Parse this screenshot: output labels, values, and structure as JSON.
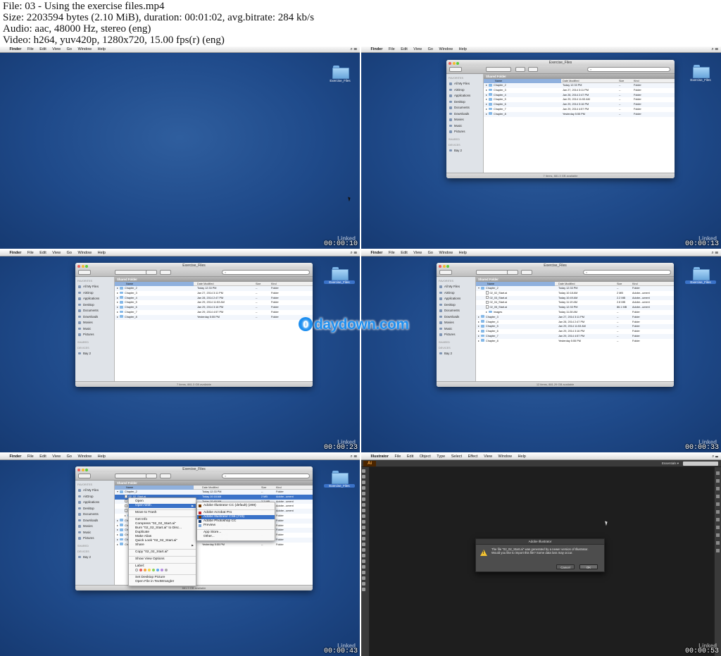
{
  "info": {
    "line1": "File: 03 - Using the exercise files.mp4",
    "line2": "Size: 2203594 bytes (2.10 MiB), duration: 00:01:02, avg.bitrate: 284 kb/s",
    "line3": "Audio: aac, 48000 Hz, stereo (eng)",
    "line4": "Video: h264, yuv420p, 1280x720, 15.00 fps(r) (eng)"
  },
  "finder_menu": [
    "Finder",
    "File",
    "Edit",
    "View",
    "Go",
    "Window",
    "Help"
  ],
  "ai_menu": [
    "Illustrator",
    "File",
    "Edit",
    "Object",
    "Type",
    "Select",
    "Effect",
    "View",
    "Window",
    "Help"
  ],
  "desktop_icon_label": "Exercise_Files",
  "window_title": "Exercise_Files",
  "shared_folder": "Shared Folder",
  "sidebar": {
    "favorites_header": "FAVORITES",
    "favorites": [
      "All My Files",
      "AirDrop",
      "Applications",
      "Desktop",
      "Documents",
      "Downloads",
      "Movies",
      "Music",
      "Pictures"
    ],
    "shared_header": "SHARED",
    "devices_header": "DEVICES",
    "devices": [
      "Bay 2"
    ]
  },
  "columns": {
    "name": "Name",
    "date": "Date Modified",
    "size": "Size",
    "kind": "Kind"
  },
  "rows": [
    {
      "name": "Chapter_2",
      "date": "Today 12:33 PM",
      "size": "--",
      "kind": "Folder"
    },
    {
      "name": "Chapter_3",
      "date": "Jan 27, 2014 3:11 PM",
      "size": "--",
      "kind": "Folder"
    },
    {
      "name": "Chapter_4",
      "date": "Jan 28, 2014 2:47 PM",
      "size": "--",
      "kind": "Folder"
    },
    {
      "name": "Chapter_5",
      "date": "Jan 29, 2014 11:53 AM",
      "size": "--",
      "kind": "Folder"
    },
    {
      "name": "Chapter_6",
      "date": "Jan 29, 2014 3:16 PM",
      "size": "--",
      "kind": "Folder"
    },
    {
      "name": "Chapter_7",
      "date": "Jan 29, 2014 4:57 PM",
      "size": "--",
      "kind": "Folder"
    },
    {
      "name": "Chapter_8",
      "date": "Yesterday 5:55 PM",
      "size": "--",
      "kind": "Folder"
    }
  ],
  "expanded_rows": [
    {
      "name": "Chapter_2",
      "date": "Today 12:33 PM",
      "size": "--",
      "kind": "Folder",
      "type": "folder",
      "open": true
    },
    {
      "name": "02_02_Start.ai",
      "date": "Today 10:18 AM",
      "size": "2 MB",
      "kind": "Adobe...ument",
      "type": "file"
    },
    {
      "name": "02_03_Start.ai",
      "date": "Today 10:49 AM",
      "size": "2.2 MB",
      "kind": "Adobe...ument",
      "type": "file"
    },
    {
      "name": "02_04_Start.ai",
      "date": "Today 11:19 AM",
      "size": "2.8 MB",
      "kind": "Adobe...ument",
      "type": "file"
    },
    {
      "name": "02_05_Start.ai",
      "date": "Today 12:33 PM",
      "size": "86.1 MB",
      "kind": "Adobe...ument",
      "type": "file"
    },
    {
      "name": "images",
      "date": "Today 11:28 AM",
      "size": "--",
      "kind": "Folder",
      "type": "folder"
    },
    {
      "name": "Chapter_3",
      "date": "Jan 27, 2014 3:11 PM",
      "size": "--",
      "kind": "Folder",
      "type": "folder"
    },
    {
      "name": "Chapter_4",
      "date": "Jan 28, 2014 2:47 PM",
      "size": "--",
      "kind": "Folder",
      "type": "folder"
    },
    {
      "name": "Chapter_5",
      "date": "Jan 29, 2014 11:53 AM",
      "size": "--",
      "kind": "Folder",
      "type": "folder"
    },
    {
      "name": "Chapter_6",
      "date": "Jan 29, 2014 3:16 PM",
      "size": "--",
      "kind": "Folder",
      "type": "folder"
    },
    {
      "name": "Chapter_7",
      "date": "Jan 29, 2014 4:57 PM",
      "size": "--",
      "kind": "Folder",
      "type": "folder"
    },
    {
      "name": "Chapter_8",
      "date": "Yesterday 5:55 PM",
      "size": "--",
      "kind": "Folder",
      "type": "folder"
    }
  ],
  "status_7": "7 items, 881.3 GB available",
  "status_7b": "7 items, 881.3 GB available",
  "status_12": "12 items, 881.29 GB available",
  "status_5": "881.3 GB available",
  "context_menu": [
    "Open",
    "Open With",
    "Move to Trash",
    "Get Info",
    "Compress \"02_02_Start.ai\"",
    "Burn \"02_02_Start.ai\" to Disc...",
    "Duplicate",
    "Make Alias",
    "Quick Look \"02_02_Start.ai\"",
    "Share",
    "Copy \"02_02_Start.ai\"",
    "Show View Options",
    "Label:",
    "Set Desktop Picture",
    "Open File in TextWrangler"
  ],
  "open_with_menu": [
    "Adobe Illustrator CC (default) (269)",
    "Adobe Acrobat Pro",
    "Adobe Illustrator CS6 (723)",
    "Adobe Photoshop CC",
    "Preview",
    "App Store...",
    "Other..."
  ],
  "label_colors": [
    "#e85d5d",
    "#f1a442",
    "#f4d64a",
    "#8fd15c",
    "#5fa8f0",
    "#b58be0",
    "#aaaaaa"
  ],
  "timestamps": [
    "00:00:10",
    "00:00:13",
    "00:00:23",
    "00:00:33",
    "00:00:43",
    "00:00:53"
  ],
  "watermark": "daydown.com",
  "watermark_mark": "0",
  "linkedin": "Linked",
  "ai": {
    "logo": "Ai",
    "workspace": "Essentials ▾",
    "dialog_title": "Adobe Illustrator",
    "dialog_msg": "The file \"02_02_Start.ai\" was generated by a newer version of Illustrator. Would you like to import this file? Some data loss may occur.",
    "cancel": "Cancel",
    "ok": "OK"
  },
  "colors": {
    "desktop": "#1f4a8a",
    "selection": "#3a72c8",
    "ai_bg": "#535353"
  }
}
